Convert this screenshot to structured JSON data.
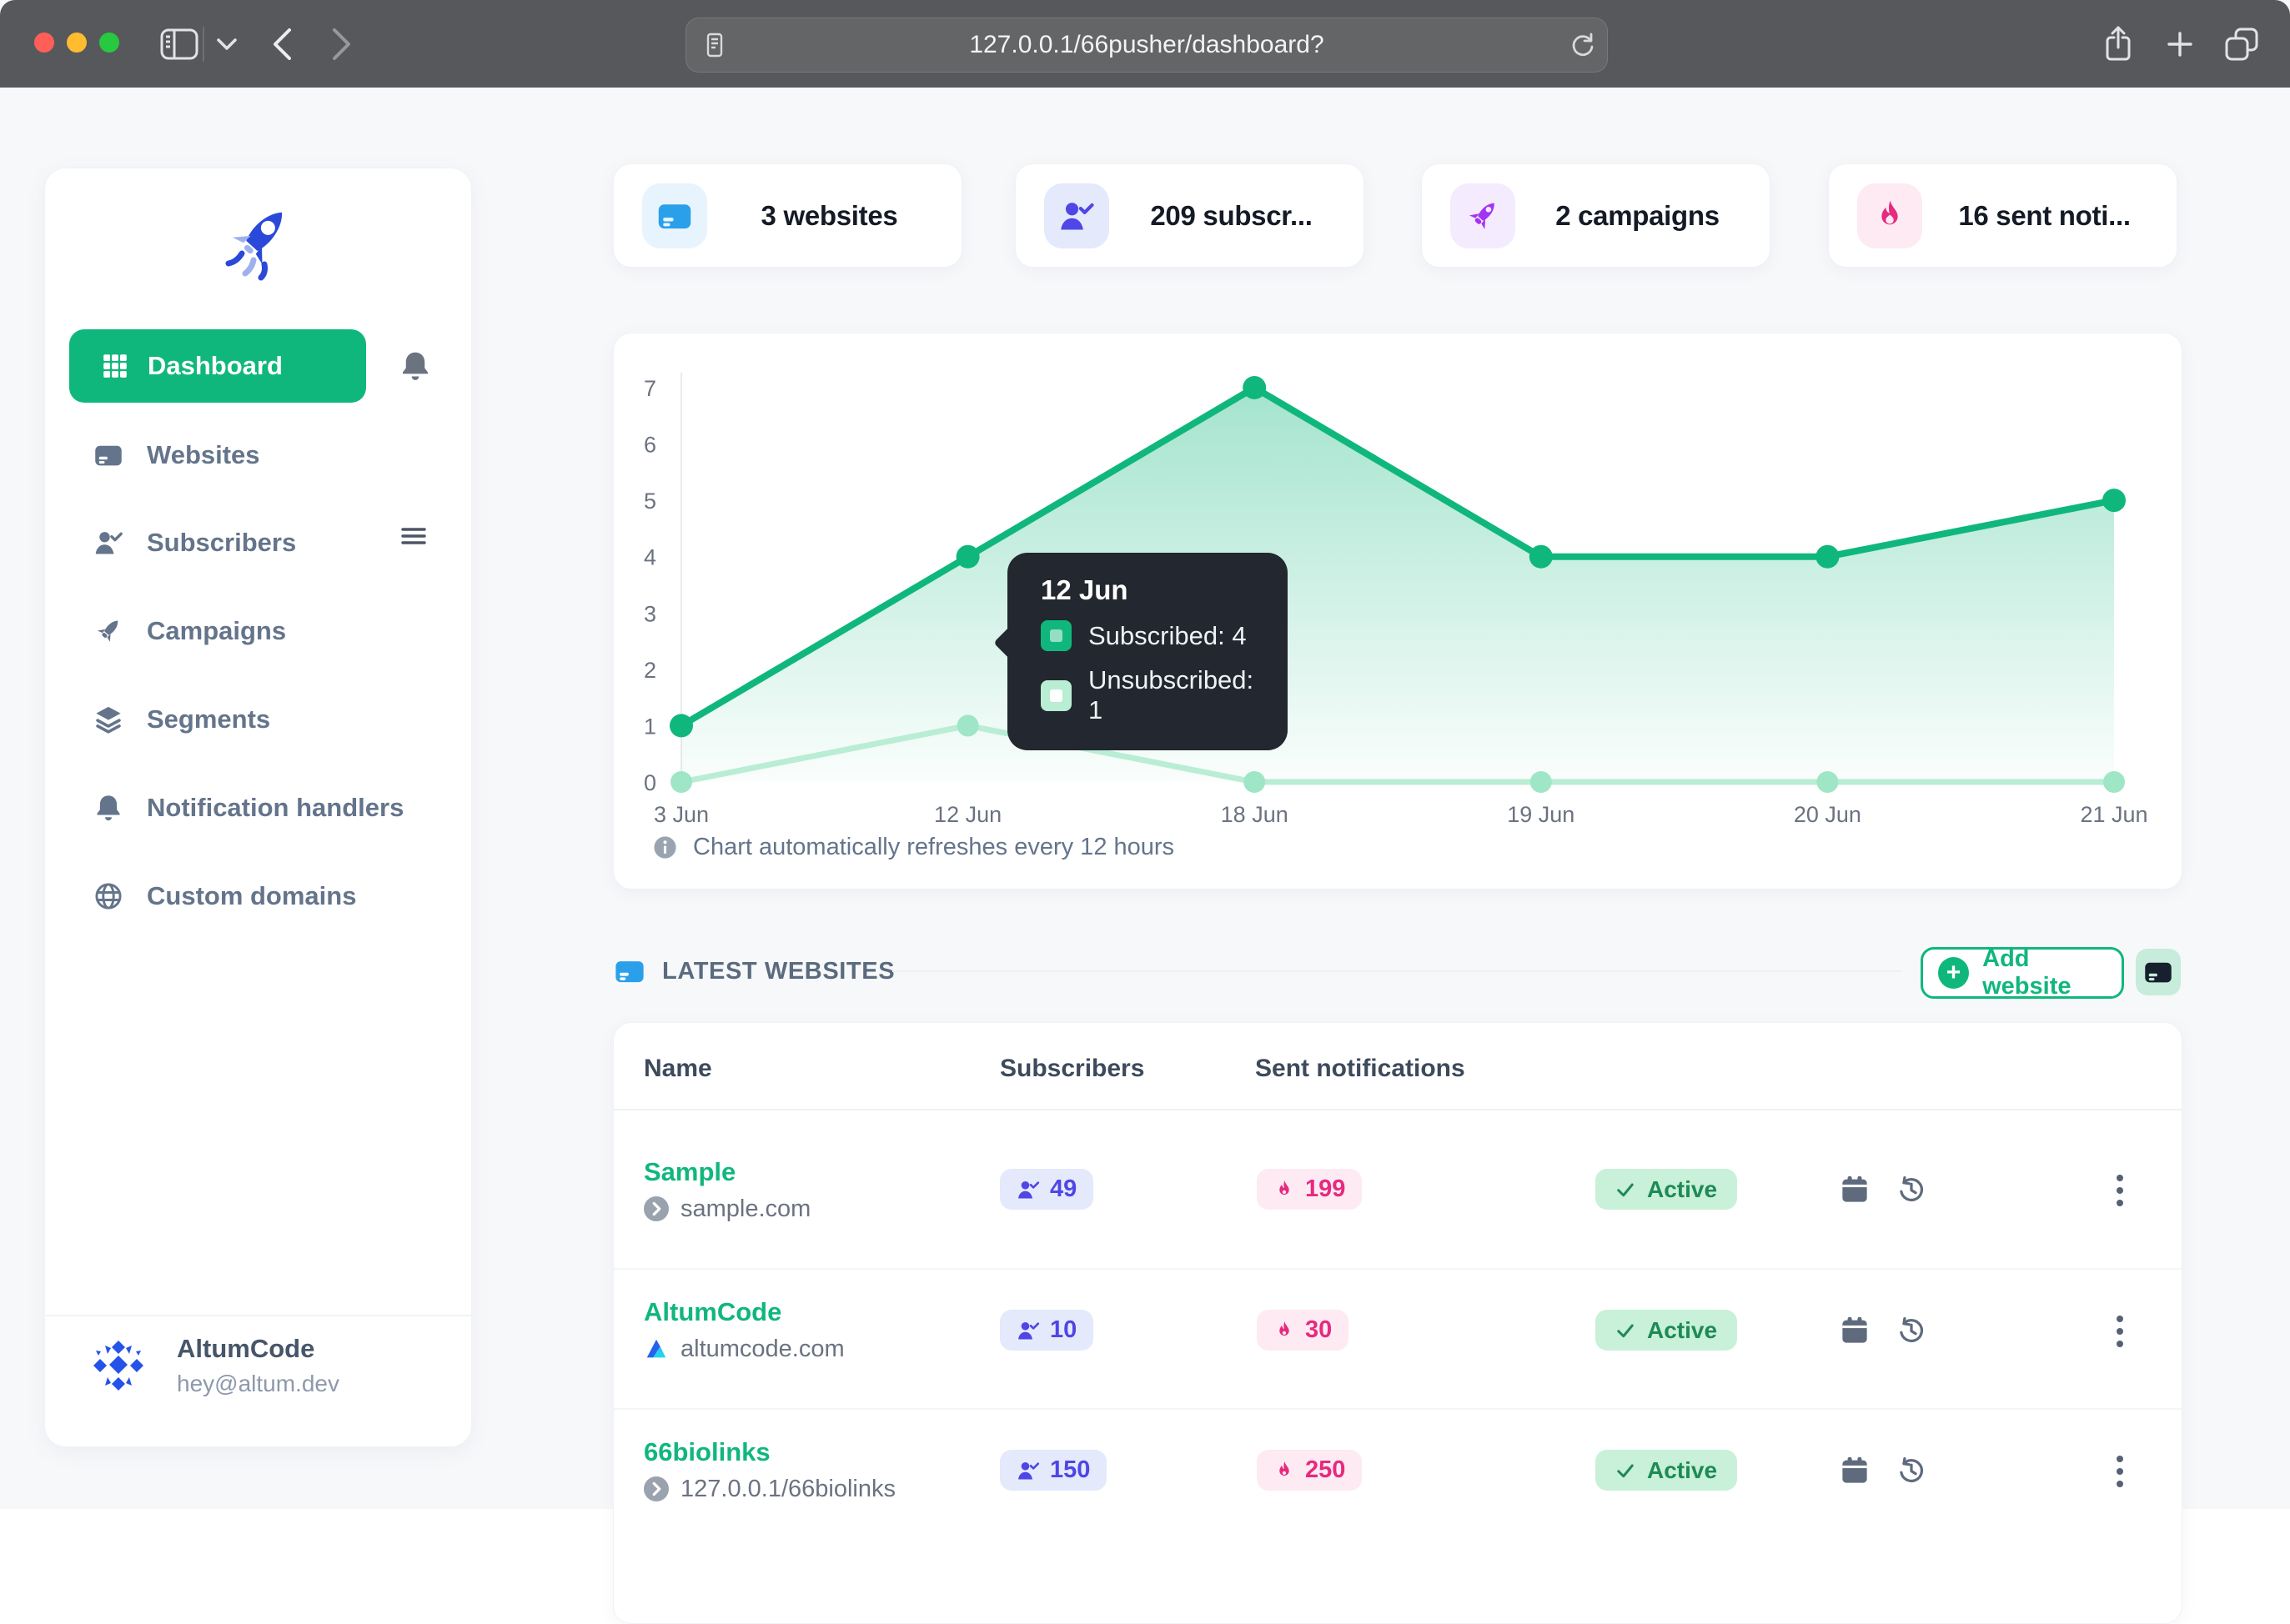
{
  "browser": {
    "url": "127.0.0.1/66pusher/dashboard?",
    "icons": [
      "sidebar-toggle",
      "tab-group-chevron",
      "back",
      "forward",
      "reader",
      "reload",
      "share",
      "new-tab",
      "tab-overview"
    ]
  },
  "colors": {
    "accent": "#10b77d",
    "accent_border": "#10b77d",
    "badge_bg": "#c9f0d9",
    "badge_text": "#1e8a55",
    "indigo": "#4f46e5",
    "indigo_bg": "#e4e9fc",
    "pink": "#e62a7f",
    "pink_bg": "#fdeaf2",
    "blue": "#2ba0ea",
    "blue_bg": "#e8f4fd",
    "purple": "#a334f2",
    "purple_bg": "#f5ebfe",
    "slate": "#64748b",
    "tooltip_bg": "#23272f"
  },
  "sidebar": {
    "nav": [
      {
        "label": "Dashboard",
        "icon": "grid-icon",
        "active": true
      },
      {
        "label": "Websites",
        "icon": "browser-card-icon",
        "active": false
      },
      {
        "label": "Subscribers",
        "icon": "person-check-icon",
        "active": false,
        "has_handle": true
      },
      {
        "label": "Campaigns",
        "icon": "rocket-icon",
        "active": false
      },
      {
        "label": "Segments",
        "icon": "layers-icon",
        "active": false
      },
      {
        "label": "Notification handlers",
        "icon": "bell-icon",
        "active": false
      },
      {
        "label": "Custom domains",
        "icon": "globe-icon",
        "active": false
      }
    ],
    "user": {
      "name": "AltumCode",
      "email": "hey@altum.dev"
    }
  },
  "stats": [
    {
      "label": "3 websites",
      "icon": "browser-card-icon",
      "color": "blue"
    },
    {
      "label": "209 subscr...",
      "icon": "person-check-icon",
      "color": "indigo"
    },
    {
      "label": "2 campaigns",
      "icon": "rocket-icon",
      "color": "purple"
    },
    {
      "label": "16 sent noti...",
      "icon": "flame-icon",
      "color": "pink"
    }
  ],
  "chart_data": {
    "type": "area",
    "x": [
      "3 Jun",
      "12 Jun",
      "18 Jun",
      "19 Jun",
      "20 Jun",
      "21 Jun"
    ],
    "series": [
      {
        "name": "Subscribed",
        "values": [
          1,
          4,
          7,
          4,
          4,
          5
        ],
        "color": "#10b77d",
        "dot": "#10b77d"
      },
      {
        "name": "Unsubscribed",
        "values": [
          0,
          1,
          0,
          0,
          0,
          0
        ],
        "color": "#b9edd4",
        "dot": "#9fe6c6"
      }
    ],
    "ylim": [
      0,
      7
    ],
    "yticks": [
      0,
      1,
      2,
      3,
      4,
      5,
      6,
      7
    ],
    "grid": false,
    "legend": "none",
    "tooltip": {
      "title": "12 Jun",
      "rows": [
        {
          "label": "Subscribed",
          "value": 4,
          "text": "Subscribed: 4"
        },
        {
          "label": "Unsubscribed",
          "value": 1,
          "text": "Unsubscribed: 1"
        }
      ]
    },
    "note": "Chart automatically refreshes every 12 hours"
  },
  "websites_section": {
    "title": "LATEST WEBSITES",
    "add_button": "Add website",
    "table": {
      "headers": [
        "Name",
        "Subscribers",
        "Sent notifications"
      ],
      "rows": [
        {
          "name": "Sample",
          "domain": "sample.com",
          "favicon": "chevron-circle",
          "subscribers": "49",
          "notifications": "199",
          "status": "Active"
        },
        {
          "name": "AltumCode",
          "domain": "altumcode.com",
          "favicon": "altumcode-logo",
          "subscribers": "10",
          "notifications": "30",
          "status": "Active"
        },
        {
          "name": "66biolinks",
          "domain": "127.0.0.1/66biolinks",
          "favicon": "chevron-circle",
          "subscribers": "150",
          "notifications": "250",
          "status": "Active"
        }
      ]
    }
  }
}
